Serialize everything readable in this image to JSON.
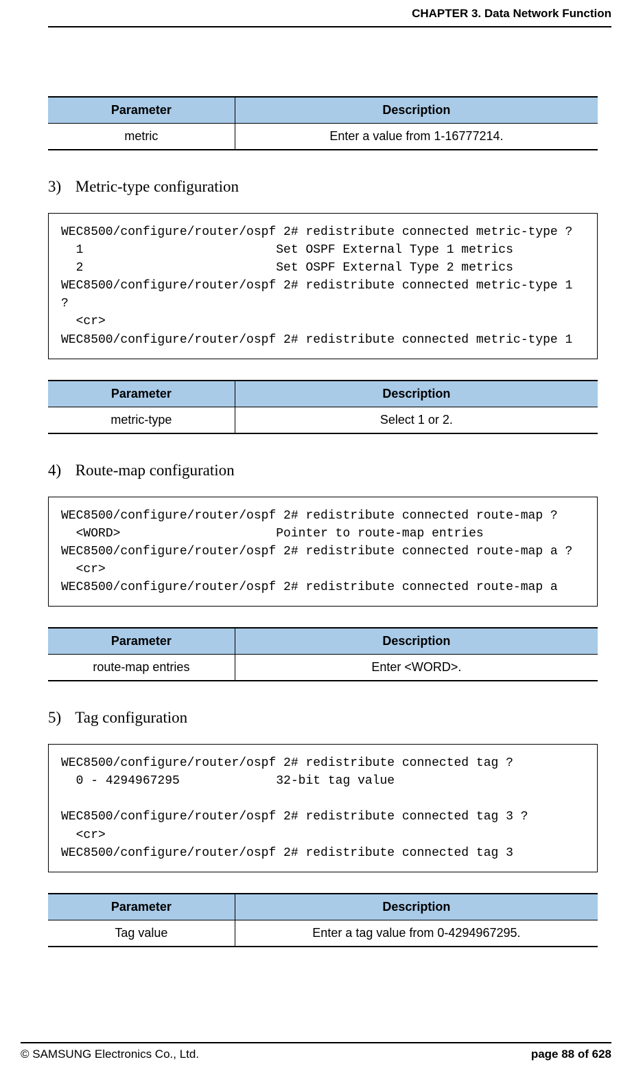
{
  "header": {
    "running": "CHAPTER 3. Data Network Function"
  },
  "tables": {
    "col_param": "Parameter",
    "col_desc": "Description",
    "t1": {
      "param": "metric",
      "desc": "Enter a value from 1-16777214."
    },
    "t2": {
      "param": "metric-type",
      "desc": "Select 1 or 2."
    },
    "t3": {
      "param": "route-map entries",
      "desc": "Enter <WORD>."
    },
    "t4": {
      "param": "Tag value",
      "desc": "Enter a tag value from 0-4294967295."
    }
  },
  "steps": {
    "s3": {
      "num": "3)",
      "title": "Metric-type configuration"
    },
    "s4": {
      "num": "4)",
      "title": "Route-map configuration"
    },
    "s5": {
      "num": "5)",
      "title": "Tag configuration"
    }
  },
  "code": {
    "c3": "WEC8500/configure/router/ospf 2# redistribute connected metric-type ?\n  1                          Set OSPF External Type 1 metrics\n  2                          Set OSPF External Type 2 metrics\nWEC8500/configure/router/ospf 2# redistribute connected metric-type 1 ?\n  <cr>\nWEC8500/configure/router/ospf 2# redistribute connected metric-type 1",
    "c4": "WEC8500/configure/router/ospf 2# redistribute connected route-map ?\n  <WORD>                     Pointer to route-map entries\nWEC8500/configure/router/ospf 2# redistribute connected route-map a ?\n  <cr>\nWEC8500/configure/router/ospf 2# redistribute connected route-map a",
    "c5": "WEC8500/configure/router/ospf 2# redistribute connected tag ?\n  0 - 4294967295             32-bit tag value\n\nWEC8500/configure/router/ospf 2# redistribute connected tag 3 ?\n  <cr>\nWEC8500/configure/router/ospf 2# redistribute connected tag 3"
  },
  "footer": {
    "left": "© SAMSUNG Electronics Co., Ltd.",
    "right": "page 88 of 628"
  }
}
